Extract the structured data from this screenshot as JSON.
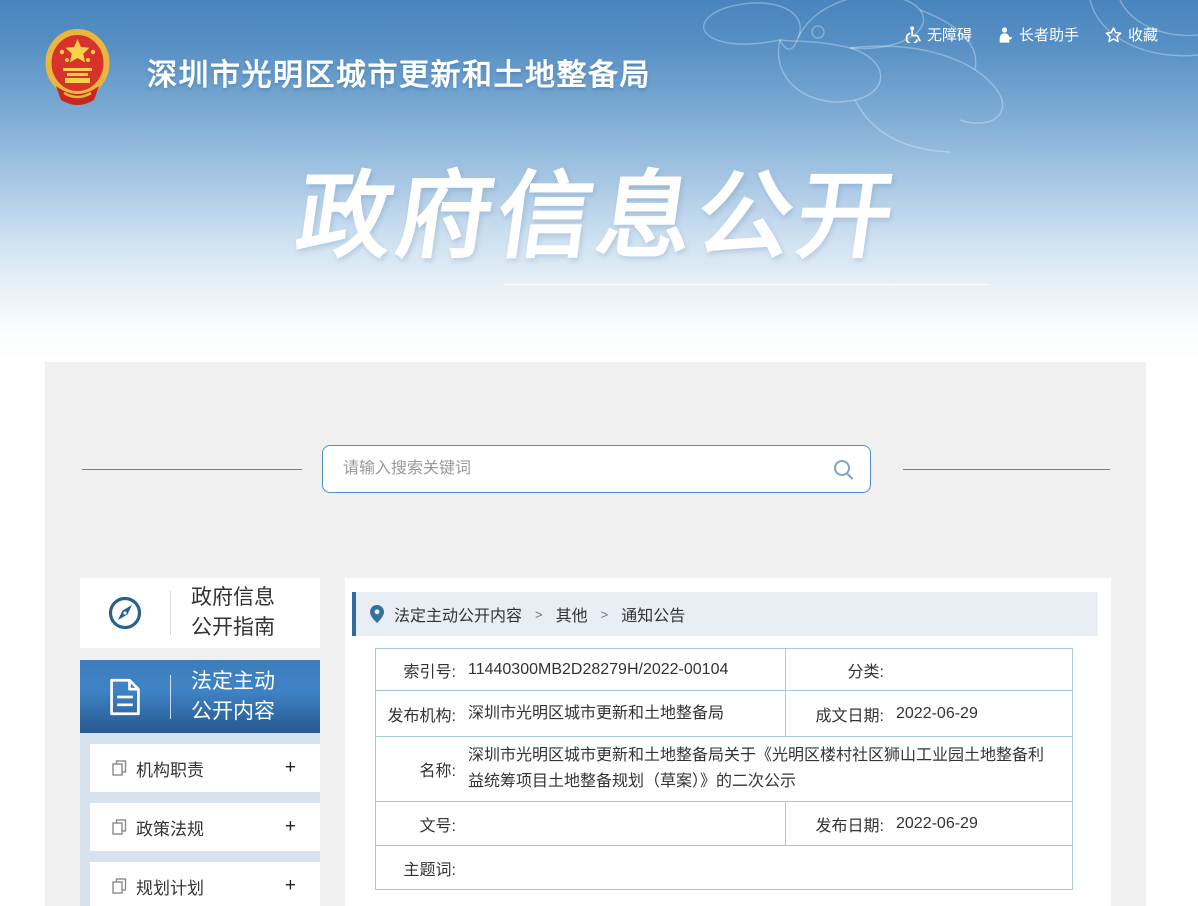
{
  "header": {
    "agency_name": "深圳市光明区城市更新和土地整备局",
    "banner_title": "政府信息公开"
  },
  "topbar": {
    "links": [
      {
        "label": "无障碍",
        "icon": "wheelchair-icon"
      },
      {
        "label": "长者助手",
        "icon": "elder-icon"
      },
      {
        "label": "收藏",
        "icon": "star-icon"
      }
    ]
  },
  "search": {
    "placeholder": "请输入搜索关键词",
    "icon": "search-icon"
  },
  "sidebar": {
    "guide": {
      "line1": "政府信息",
      "line2": "公开指南",
      "icon": "compass-icon"
    },
    "statutory": {
      "line1": "法定主动",
      "line2": "公开内容",
      "icon": "document-icon"
    },
    "subitems": [
      {
        "label": "机构职责",
        "toggle": "+"
      },
      {
        "label": "政策法规",
        "toggle": "+"
      },
      {
        "label": "规划计划",
        "toggle": "+"
      }
    ]
  },
  "breadcrumb": {
    "items": [
      "法定主动公开内容",
      "其他",
      "通知公告"
    ],
    "separator": ">"
  },
  "info_table": {
    "rows": {
      "r1": {
        "label_left": "索引号:",
        "value_left": "11440300MB2D28279H/2022-00104",
        "label_right": "分类:",
        "value_right": ""
      },
      "r2": {
        "label_left": "发布机构:",
        "value_left": "深圳市光明区城市更新和土地整备局",
        "label_right": "成文日期:",
        "value_right": "2022-06-29"
      },
      "r3": {
        "label": "名称:",
        "value": "深圳市光明区城市更新和土地整备局关于《光明区楼村社区狮山工业园土地整备利益统筹项目土地整备规划（草案）》的二次公示"
      },
      "r4": {
        "label_left": "文号:",
        "value_left": "",
        "label_right": "发布日期:",
        "value_right": "2022-06-29"
      },
      "r5": {
        "label": "主题词:",
        "value": ""
      }
    }
  },
  "colors": {
    "banner_top_blue": "#4885bd",
    "accent_blue": "#2e6ca8",
    "active_item_blue": "#3f83c6",
    "table_border": "#a9c6e2",
    "breadcrumb_bg": "#e9eef4",
    "panel_bg": "#f0f0f0",
    "sidebar_bg": "#d6e3ee"
  }
}
